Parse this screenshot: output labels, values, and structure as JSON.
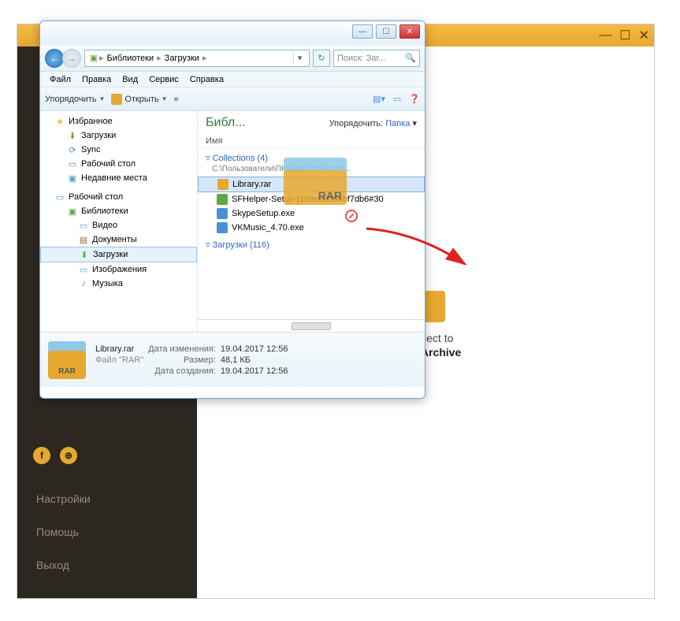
{
  "bg": {
    "win": {
      "min": "—",
      "max": "☐",
      "close": "✕"
    },
    "menu": {
      "settings": "Настройки",
      "help": "Помощь",
      "exit": "Выход"
    },
    "drop": {
      "line1": "or Select to",
      "line2": "Open Archive"
    }
  },
  "explorer": {
    "win": {
      "min": "—",
      "max": "☐",
      "close": "✕"
    },
    "nav": {
      "back": "←",
      "fwd": "→",
      "crumbs": [
        "Библиотеки",
        "Загрузки"
      ],
      "search_placeholder": "Поиск: Заг..."
    },
    "menu": [
      "Файл",
      "Правка",
      "Вид",
      "Сервис",
      "Справка"
    ],
    "toolbar": {
      "organize": "Упорядочить",
      "open": "Открыть",
      "more": "»"
    },
    "tree": {
      "favorites": "Избранное",
      "fav_items": [
        "Загрузки",
        "Sync",
        "Рабочий стол",
        "Недавние места"
      ],
      "desktop": "Рабочий стол",
      "libraries": "Библиотеки",
      "lib_items": [
        "Видео",
        "Документы",
        "Загрузки",
        "Изображения",
        "Музыка"
      ]
    },
    "list": {
      "header": "Библ...",
      "sort_label": "Упорядочить:",
      "sort_value": "Папка",
      "col": "Имя",
      "groups": [
        {
          "title": "Collections (4)",
          "sub": "C:\\Пользователи\\ПК\\AppData\\Roami..."
        }
      ],
      "files": [
        {
          "name": "Library.rar",
          "icon": "rar",
          "selected": true
        },
        {
          "name": "SFHelper-Setup-[199ea00d4bf7db6#30",
          "icon": "dl"
        },
        {
          "name": "SkypeSetup.exe",
          "icon": "exe"
        },
        {
          "name": "VKMusic_4.70.exe",
          "icon": "exe"
        }
      ],
      "group2": "Загрузки (116)"
    },
    "details": {
      "filename": "Library.rar",
      "filetype": "Файл \"RAR\"",
      "labels": {
        "modified": "Дата изменения:",
        "size": "Размер:",
        "created": "Дата создания:"
      },
      "modified": "19.04.2017 12:56",
      "size": "48,1 КБ",
      "created": "19.04.2017 12:56"
    }
  },
  "drag": {
    "label": "RAR"
  }
}
